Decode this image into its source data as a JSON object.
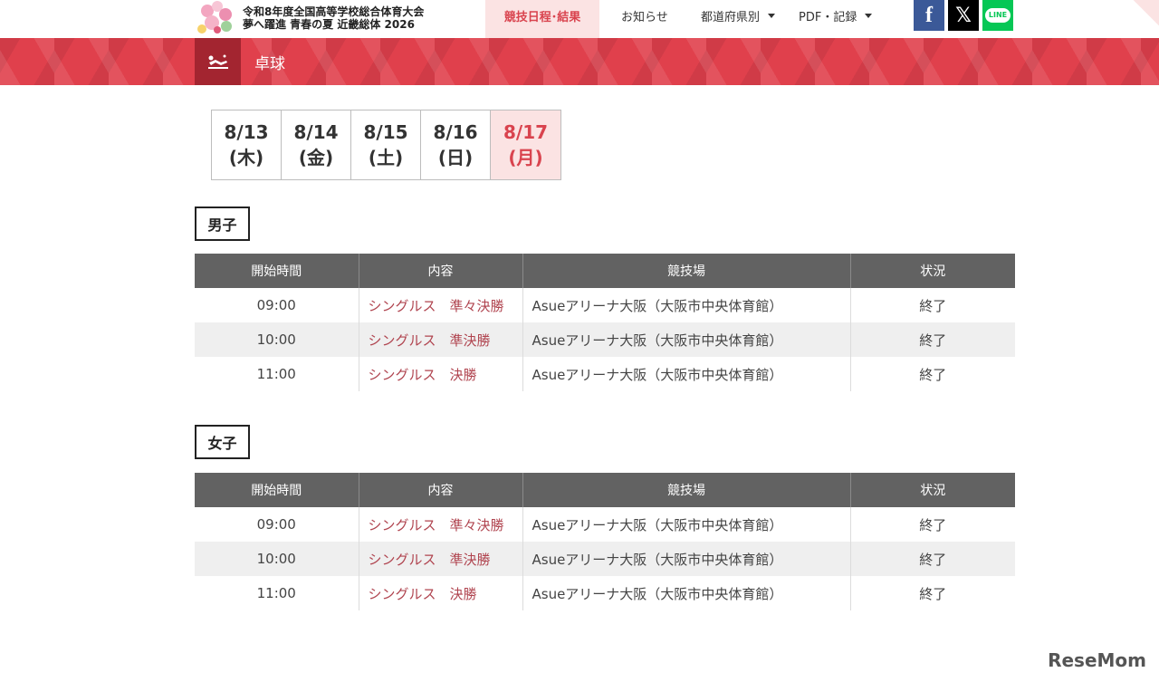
{
  "header": {
    "logo_line1": "令和8年度全国高等学校総合体育大会",
    "logo_line2": "夢へ躍進 青春の夏 近畿総体 2026",
    "nav": [
      {
        "label": "競技日程･結果",
        "active": true,
        "dropdown": false
      },
      {
        "label": "お知らせ",
        "active": false,
        "dropdown": false
      },
      {
        "label": "都道府県別",
        "active": false,
        "dropdown": true
      },
      {
        "label": "PDF・記録",
        "active": false,
        "dropdown": true
      }
    ],
    "social": {
      "facebook": "f",
      "x": "𝕏",
      "line": "LINE"
    }
  },
  "sport": {
    "icon": "table-tennis-icon",
    "title": "卓球"
  },
  "date_tabs": [
    {
      "date": "8/13",
      "weekday": "(木)",
      "active": false
    },
    {
      "date": "8/14",
      "weekday": "(金)",
      "active": false
    },
    {
      "date": "8/15",
      "weekday": "(土)",
      "active": false
    },
    {
      "date": "8/16",
      "weekday": "(日)",
      "active": false
    },
    {
      "date": "8/17",
      "weekday": "(月)",
      "active": true
    }
  ],
  "table_headers": {
    "time": "開始時間",
    "event": "内容",
    "venue": "競技場",
    "status": "状況"
  },
  "sections": [
    {
      "label": "男子",
      "rows": [
        {
          "time": "09:00",
          "event": "シングルス　準々決勝",
          "venue": "Asueアリーナ大阪（大阪市中央体育館）",
          "status": "終了"
        },
        {
          "time": "10:00",
          "event": "シングルス　準決勝",
          "venue": "Asueアリーナ大阪（大阪市中央体育館）",
          "status": "終了"
        },
        {
          "time": "11:00",
          "event": "シングルス　決勝",
          "venue": "Asueアリーナ大阪（大阪市中央体育館）",
          "status": "終了"
        }
      ]
    },
    {
      "label": "女子",
      "rows": [
        {
          "time": "09:00",
          "event": "シングルス　準々決勝",
          "venue": "Asueアリーナ大阪（大阪市中央体育館）",
          "status": "終了"
        },
        {
          "time": "10:00",
          "event": "シングルス　準決勝",
          "venue": "Asueアリーナ大阪（大阪市中央体育館）",
          "status": "終了"
        },
        {
          "time": "11:00",
          "event": "シングルス　決勝",
          "venue": "Asueアリーナ大阪（大阪市中央体育館）",
          "status": "終了"
        }
      ]
    }
  ],
  "watermark": "ReseMom",
  "colors": {
    "accent": "#d9434e",
    "band": "#e0404c",
    "table_header": "#626262",
    "event_link": "#b0444f"
  }
}
